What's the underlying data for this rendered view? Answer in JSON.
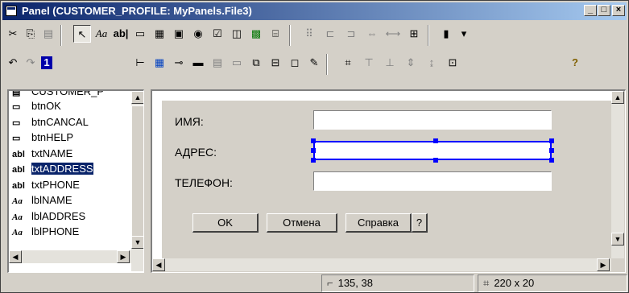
{
  "window": {
    "title": "Panel (CUSTOMER_PROFILE: MyPanels.File3)",
    "minimize": "_",
    "maximize": "□",
    "close": "×"
  },
  "toolbar1": {
    "cut_icon": "cut-icon",
    "copy_icon": "copy-icon",
    "paste_icon": "paste-icon",
    "pointer_icon": "pointer-icon",
    "label_tool": "Aa",
    "entry_tool": "ab|",
    "more": "▾"
  },
  "toolbar2": {
    "help_icon": "help-icon",
    "info_label": "1"
  },
  "tree": {
    "root": "CUSTOMER_P",
    "items": [
      {
        "icon": "button-icon",
        "label": "btnOK",
        "selected": false
      },
      {
        "icon": "button-icon",
        "label": "btnCANCAL",
        "selected": false
      },
      {
        "icon": "button-icon",
        "label": "btnHELP",
        "selected": false
      },
      {
        "icon": "entryfield-icon",
        "label": "txtNAME",
        "selected": false
      },
      {
        "icon": "entryfield-icon",
        "label": "txtADDRESS",
        "selected": true
      },
      {
        "icon": "entryfield-icon",
        "label": "txtPHONE",
        "selected": false
      },
      {
        "icon": "label-icon",
        "label": "lblNAME",
        "selected": false
      },
      {
        "icon": "label-icon",
        "label": "lblADDRES",
        "selected": false
      },
      {
        "icon": "label-icon",
        "label": "lblPHONE",
        "selected": false
      }
    ],
    "entry_glyph": "abl",
    "label_glyph": "Aa"
  },
  "form": {
    "name_label": "ИМЯ:",
    "address_label": "АДРЕС:",
    "phone_label": "ТЕЛЕФОН:",
    "name_value": "",
    "address_value": "",
    "phone_value": "",
    "ok_label": "OK",
    "cancel_label": "Отмена",
    "help_label": "Справка",
    "question_label": "?"
  },
  "status": {
    "position": "135, 38",
    "size": "220 x 20"
  }
}
